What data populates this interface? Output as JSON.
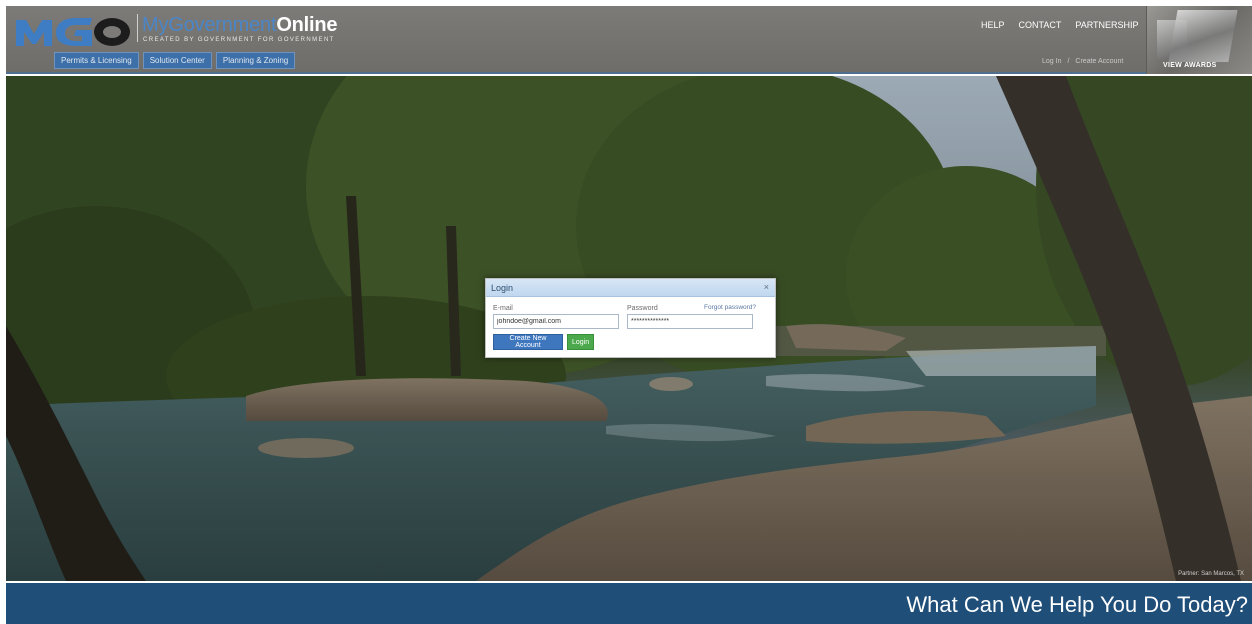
{
  "brand": {
    "logo_letters": "MGO",
    "name_part1": "MyGovernment",
    "name_part2": "Online",
    "tagline": "CREATED BY GOVERNMENT FOR GOVERNMENT"
  },
  "nav": {
    "tabs": [
      "Permits & Licensing",
      "Solution Center",
      "Planning & Zoning"
    ]
  },
  "top_links": [
    "HELP",
    "CONTACT",
    "PARTNERSHIP"
  ],
  "account": {
    "login": "Log In",
    "separator": "/",
    "create": "Create Account"
  },
  "awards": {
    "label": "VIEW AWARDS"
  },
  "hero": {
    "caption": "Partner: San Marcos, TX"
  },
  "login": {
    "title": "Login",
    "close": "×",
    "email_label": "E-mail",
    "email_value": "johndoe@gmail.com",
    "password_label": "Password",
    "password_value": "**************",
    "forgot": "Forgot password?",
    "create_button": "Create New Account",
    "login_button": "Login"
  },
  "banner": {
    "text": "What Can We Help You Do Today?"
  },
  "colors": {
    "banner_bg": "#1f4e79",
    "create_button": "#3f77bf",
    "login_button": "#4ca84c",
    "brand_blue": "#4a86c8"
  }
}
